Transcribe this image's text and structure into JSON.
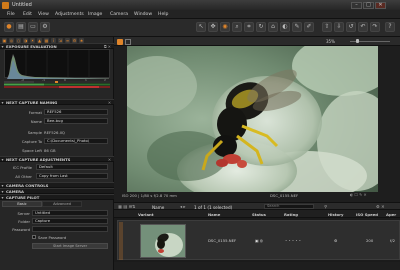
{
  "window": {
    "title": "Untitled",
    "minimize": "–",
    "maximize": "□",
    "close": "✕"
  },
  "menu": [
    "File",
    "Edit",
    "View",
    "Adjustments",
    "Image",
    "Camera",
    "Window",
    "Help"
  ],
  "toolbar": {
    "zoom": "35%"
  },
  "left": {
    "exposure_header": "EXPOSURE EVALUATION",
    "histogram_ticks": [
      "-2",
      "-1",
      "0",
      "1",
      "2"
    ],
    "naming_header": "NEXT CAPTURE NAMING",
    "format_label": "Format",
    "format_value": "REF526",
    "name_label": "Name",
    "name_value": "Bee-bug",
    "sample_label": "Sample",
    "sample_value": "REF526.IIQ",
    "capture_to_label": "Capture To",
    "capture_to_value": "C:\\Documents\\_Photo\\",
    "space_left_label": "Space Left",
    "space_left_value": "86 GB",
    "adjustments_header": "NEXT CAPTURE ADJUSTMENTS",
    "icc_label": "ICC Profile",
    "icc_value": "Default",
    "all_other_label": "All Other",
    "all_other_value": "Copy from Last",
    "camera_controls_header": "CAMERA CONTROLS",
    "camera_header": "CAMERA",
    "capture_pilot_header": "CAPTURE PILOT",
    "tabs": [
      "Basic",
      "Advanced"
    ],
    "server_label": "Server",
    "server_value": "Untitled",
    "folder_label": "Folder",
    "folder_value": "Capture",
    "password_label": "Password",
    "save_password_label": "Save Password",
    "start_server_button": "Start Image Server"
  },
  "viewer": {
    "caption_left": "ISO 200  |  1/80 s  f/2.8  70 mm",
    "caption_center": "DSC_0155.NEF"
  },
  "browser": {
    "sort_label": "Name",
    "selection_text": "1 of 1 (1 selected)",
    "search_placeholder": "Search",
    "columns": [
      "Variant",
      "Name",
      "Status",
      "Rating",
      "History",
      "ISO Speed",
      "Aper"
    ],
    "rows": [
      {
        "name": "DSC_0155.NEF",
        "iso": "200",
        "aperture": "f/2"
      }
    ]
  },
  "colors": {
    "accent": "#e0852a",
    "panel": "#262626",
    "header": "#1a1a1a"
  }
}
